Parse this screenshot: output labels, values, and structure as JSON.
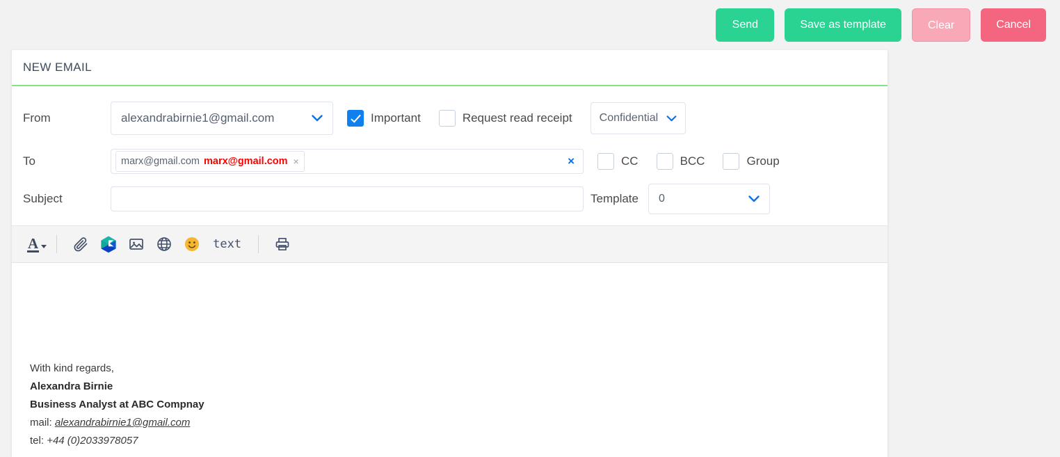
{
  "action_bar": {
    "buttons": [
      {
        "label": "Send",
        "name": "send-button",
        "color": "#2ad392"
      },
      {
        "label": "Save as template",
        "name": "save-as-template-button",
        "color": "#2ad392"
      },
      {
        "label": "Clear",
        "name": "clear-button",
        "color": "#f9a8b8"
      },
      {
        "label": "Cancel",
        "name": "cancel-button",
        "color": "#f4657f"
      }
    ]
  },
  "card": {
    "title": "NEW EMAIL",
    "accent_color": "#84e484"
  },
  "form": {
    "from": {
      "label": "From",
      "value": "alexandrabirnie1@gmail.com",
      "chevron": "chevron-down-icon"
    },
    "important": {
      "label": "Important",
      "checked": true,
      "checkbox_color": "#1080ef"
    },
    "read_receipt": {
      "label": "Request read receipt",
      "checked": false
    },
    "confidentiality": {
      "value": "Confidential",
      "chevron": "chevron-down-icon"
    },
    "to": {
      "label": "To",
      "chip": {
        "plain_text": "marx@gmail.com",
        "strong_text": "marx@gmail.com",
        "strong_color": "#ff0000",
        "remove_icon": "close-icon"
      },
      "clear_icon": "clear-icon",
      "input_value": "",
      "placeholder": ""
    },
    "cc": {
      "label": "CC",
      "checked": false
    },
    "bcc": {
      "label": "BCC",
      "checked": false
    },
    "group": {
      "label": "Group",
      "checked": false
    },
    "subject": {
      "label": "Subject",
      "value": "",
      "placeholder": ""
    },
    "template": {
      "label": "Template",
      "value": "0",
      "chevron": "chevron-down-icon"
    }
  },
  "toolbar": {
    "items": [
      {
        "name": "text-color-icon",
        "glyph": "A"
      },
      {
        "name": "attachment-icon",
        "glyph": "paperclip"
      },
      {
        "name": "cloud-storage-icon",
        "glyph": "hexagon"
      },
      {
        "name": "insert-image-icon",
        "glyph": "image"
      },
      {
        "name": "insert-link-icon",
        "glyph": "globe"
      },
      {
        "name": "emoji-icon",
        "glyph": "smiley"
      },
      {
        "name": "plain-text-button",
        "glyph": "text"
      },
      {
        "name": "print-icon",
        "glyph": "printer"
      }
    ],
    "text_label": "text"
  },
  "body": {
    "signature": {
      "regards": "With kind regards,",
      "name": "Alexandra Birnie",
      "role": "Business Analyst at ABC Compnay",
      "mail_label": "mail:",
      "mail_value": "alexandrabirnie1@gmail.com",
      "tel_label": "tel:",
      "tel_value": "+44 (0)2033978057"
    }
  }
}
